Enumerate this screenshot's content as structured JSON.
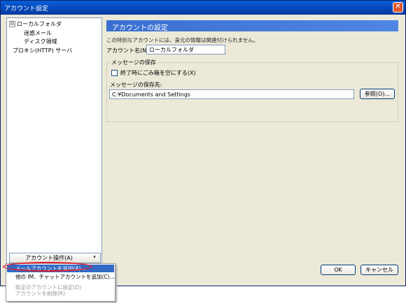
{
  "window": {
    "title": "アカウント設定",
    "close_glyph": "✕"
  },
  "tree": {
    "items": [
      {
        "label": "ローカルフォルダ",
        "expander": "⊟"
      },
      {
        "label": "迷惑メール"
      },
      {
        "label": "ディスク領域"
      },
      {
        "label": "プロキシ(HTTP) サーバ"
      }
    ]
  },
  "panel": {
    "header": "アカウントの設定",
    "description": "この特別なアカウントには、身元の情報は関連付けられません。",
    "account_name_label": "アカウント名(N):",
    "account_name_value": "ローカルフォルダ",
    "message_storage_title": "メッセージの保存",
    "empty_trash_label": "終了時にごみ箱を空にする(X)",
    "message_store_label": "メッセージの保存先:",
    "message_store_value": "C:¥Documents and Settings",
    "browse_label": "参照(O)..."
  },
  "account_actions": {
    "selected": "アカウント操作(A)",
    "arrow": "▾",
    "menu": [
      {
        "label": "メールアカウントを追加(A)..."
      },
      {
        "label": "他の IM、チャットアカウントを追加(C)..."
      },
      {
        "label": "既定のアカウントに設定(D)"
      },
      {
        "label": "アカウントを削除(R)"
      }
    ]
  },
  "footer": {
    "ok_label": "OK",
    "cancel_label": "キャンセル"
  }
}
